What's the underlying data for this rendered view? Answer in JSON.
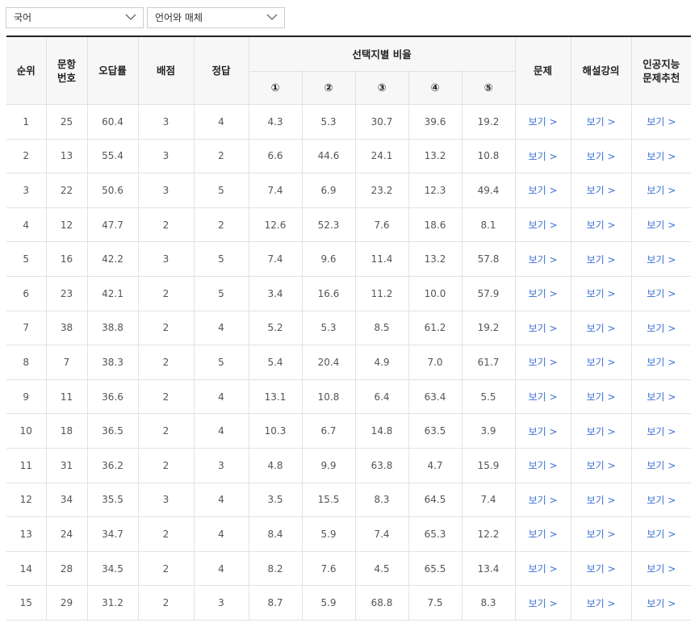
{
  "filters": {
    "subject": "국어",
    "elective": "언어와 매체"
  },
  "table": {
    "headers": {
      "rank": "순위",
      "question_no_line1": "문항",
      "question_no_line2": "번호",
      "error_rate": "오답률",
      "points": "배점",
      "answer": "정답",
      "choice_ratio": "선택지별 비율",
      "choices": [
        "①",
        "②",
        "③",
        "④",
        "⑤"
      ],
      "problem": "문제",
      "lecture": "해설강의",
      "ai_line1": "인공지능",
      "ai_line2": "문제추천"
    },
    "link_label": "보기 >",
    "rows": [
      {
        "rank": "1",
        "q": "25",
        "err": "60.4",
        "pts": "3",
        "ans": "4",
        "c": [
          "4.3",
          "5.3",
          "30.7",
          "39.6",
          "19.2"
        ]
      },
      {
        "rank": "2",
        "q": "13",
        "err": "55.4",
        "pts": "3",
        "ans": "2",
        "c": [
          "6.6",
          "44.6",
          "24.1",
          "13.2",
          "10.8"
        ]
      },
      {
        "rank": "3",
        "q": "22",
        "err": "50.6",
        "pts": "3",
        "ans": "5",
        "c": [
          "7.4",
          "6.9",
          "23.2",
          "12.3",
          "49.4"
        ]
      },
      {
        "rank": "4",
        "q": "12",
        "err": "47.7",
        "pts": "2",
        "ans": "2",
        "c": [
          "12.6",
          "52.3",
          "7.6",
          "18.6",
          "8.1"
        ]
      },
      {
        "rank": "5",
        "q": "16",
        "err": "42.2",
        "pts": "3",
        "ans": "5",
        "c": [
          "7.4",
          "9.6",
          "11.4",
          "13.2",
          "57.8"
        ]
      },
      {
        "rank": "6",
        "q": "23",
        "err": "42.1",
        "pts": "2",
        "ans": "5",
        "c": [
          "3.4",
          "16.6",
          "11.2",
          "10.0",
          "57.9"
        ]
      },
      {
        "rank": "7",
        "q": "38",
        "err": "38.8",
        "pts": "2",
        "ans": "4",
        "c": [
          "5.2",
          "5.3",
          "8.5",
          "61.2",
          "19.2"
        ]
      },
      {
        "rank": "8",
        "q": "7",
        "err": "38.3",
        "pts": "2",
        "ans": "5",
        "c": [
          "5.4",
          "20.4",
          "4.9",
          "7.0",
          "61.7"
        ]
      },
      {
        "rank": "9",
        "q": "11",
        "err": "36.6",
        "pts": "2",
        "ans": "4",
        "c": [
          "13.1",
          "10.8",
          "6.4",
          "63.4",
          "5.5"
        ]
      },
      {
        "rank": "10",
        "q": "18",
        "err": "36.5",
        "pts": "2",
        "ans": "4",
        "c": [
          "10.3",
          "6.7",
          "14.8",
          "63.5",
          "3.9"
        ]
      },
      {
        "rank": "11",
        "q": "31",
        "err": "36.2",
        "pts": "2",
        "ans": "3",
        "c": [
          "4.8",
          "9.9",
          "63.8",
          "4.7",
          "15.9"
        ]
      },
      {
        "rank": "12",
        "q": "34",
        "err": "35.5",
        "pts": "3",
        "ans": "4",
        "c": [
          "3.5",
          "15.5",
          "8.3",
          "64.5",
          "7.4"
        ]
      },
      {
        "rank": "13",
        "q": "24",
        "err": "34.7",
        "pts": "2",
        "ans": "4",
        "c": [
          "8.4",
          "5.9",
          "7.4",
          "65.3",
          "12.2"
        ]
      },
      {
        "rank": "14",
        "q": "28",
        "err": "34.5",
        "pts": "2",
        "ans": "4",
        "c": [
          "8.2",
          "7.6",
          "4.5",
          "65.5",
          "13.4"
        ]
      },
      {
        "rank": "15",
        "q": "29",
        "err": "31.2",
        "pts": "2",
        "ans": "3",
        "c": [
          "8.7",
          "5.9",
          "68.8",
          "7.5",
          "8.3"
        ]
      }
    ]
  },
  "colors": {
    "link": "#3b6fd6",
    "header_bg": "#f7f7f7",
    "border": "#e2e2e2",
    "top_rule": "#222222"
  }
}
